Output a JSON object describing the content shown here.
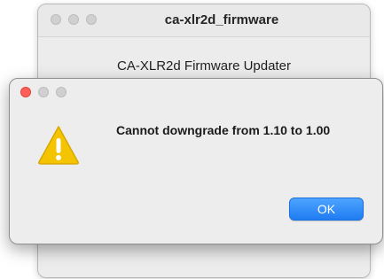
{
  "background_window": {
    "title": "ca-xlr2d_firmware",
    "heading": "CA-XLR2d Firmware Updater"
  },
  "alert": {
    "icon": "warning-icon",
    "message": "Cannot downgrade from 1.10 to 1.00",
    "ok_label": "OK",
    "colors": {
      "accent": "#1f7cf2",
      "close": "#ff5f57",
      "warning": "#f5c400"
    }
  }
}
